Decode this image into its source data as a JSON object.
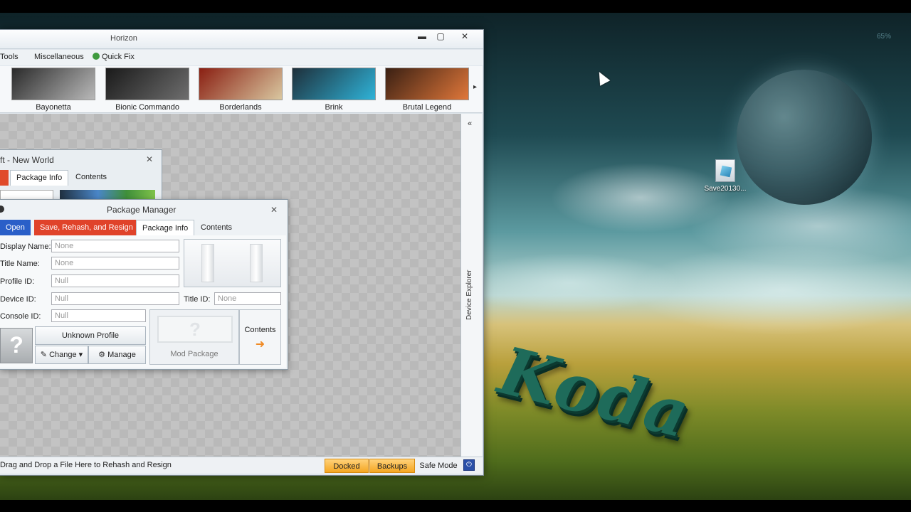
{
  "desktop": {
    "battery_text": "65%",
    "file_icon_label": "Save20130...",
    "wallpaper_text": "Koda"
  },
  "app": {
    "title": "Horizon",
    "window_buttons": {
      "minimize": "▬",
      "maximize": "▢",
      "close": "✕"
    },
    "menu": {
      "tools": "Tools",
      "misc": "Miscellaneous",
      "quickfix": "Quick Fix"
    },
    "games": [
      {
        "name": "Bayonetta",
        "color1": "#2a2a2a",
        "color2": "#b9b9b9"
      },
      {
        "name": "Bionic Commando",
        "color1": "#1a1a1a",
        "color2": "#6e6e6e"
      },
      {
        "name": "Borderlands",
        "color1": "#8a1f12",
        "color2": "#d9c7a0"
      },
      {
        "name": "Brink",
        "color1": "#1e2f3a",
        "color2": "#2fb3d8"
      },
      {
        "name": "Brutal Legend",
        "color1": "#3a2013",
        "color2": "#e0773a"
      }
    ],
    "strip_arrow": "▸",
    "device_explorer": {
      "collapse": "«",
      "label": "Device Explorer"
    },
    "status": {
      "text": "Drag and Drop a File Here to Rehash and Resign",
      "docked": "Docked",
      "backups": "Backups",
      "safe_mode": "Safe Mode"
    }
  },
  "back_window": {
    "title": "ft - New World",
    "close": "✕",
    "tabs": [
      "Package Info",
      "Contents"
    ]
  },
  "package_manager": {
    "title": "Package Manager",
    "close": "✕",
    "tabs": {
      "open": "Open",
      "save": "Save, Rehash, and Resign",
      "package_info": "Package Info",
      "contents": "Contents"
    },
    "fields": {
      "display_name_label": "Display Name:",
      "display_name": "None",
      "title_name_label": "Title Name:",
      "title_name": "None",
      "profile_id_label": "Profile ID:",
      "profile_id": "Null",
      "device_id_label": "Device ID:",
      "device_id": "Null",
      "title_id_label": "Title ID:",
      "title_id": "None",
      "console_id_label": "Console ID:",
      "console_id": "Null"
    },
    "profile": {
      "unknown": "Unknown Profile",
      "change": "Change",
      "manage": "Manage",
      "question": "?"
    },
    "mod_package": "Mod Package",
    "contents_button": "Contents",
    "contents_arrow": "➜"
  }
}
